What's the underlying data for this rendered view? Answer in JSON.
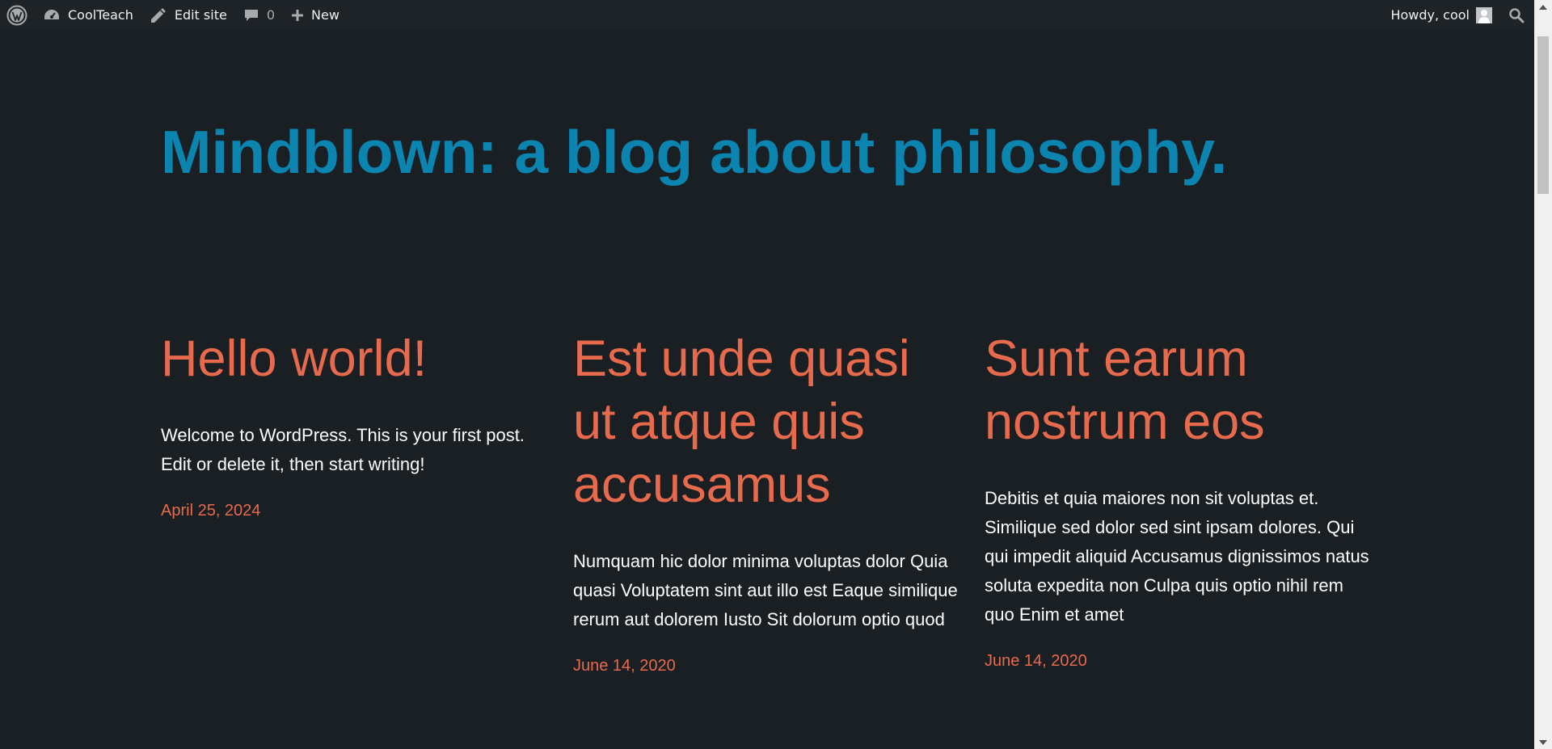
{
  "admin_bar": {
    "site_name": "CoolTeach",
    "edit_site": "Edit site",
    "comments_count": "0",
    "new_label": "New",
    "greeting": "Howdy, cool"
  },
  "site": {
    "title": "Mindblown: a blog about philosophy."
  },
  "posts": [
    {
      "title": "Hello world!",
      "excerpt": "Welcome to WordPress. This is your first post. Edit or delete it, then start writing!",
      "date": "April 25, 2024"
    },
    {
      "title": "Est unde quasi ut atque quis accusamus",
      "excerpt": "Numquam hic dolor minima voluptas dolor Quia quasi Voluptatem sint aut illo est Eaque similique rerum aut dolorem Iusto Sit dolorum optio quod",
      "date": "June 14, 2020"
    },
    {
      "title": "Sunt earum nostrum eos",
      "excerpt": "Debitis et quia maiores non sit voluptas et. Similique sed dolor sed sint ipsam dolores. Qui qui impedit aliquid Accusamus dignissimos natus soluta expedita non Culpa quis optio nihil rem quo Enim et amet",
      "date": "June 14, 2020"
    }
  ],
  "colors": {
    "background": "#1a1f24",
    "admin_bar": "#1d2327",
    "site_title": "#0b84b0",
    "accent": "#e86a4c",
    "text": "#ffffff"
  },
  "icons": {
    "wordpress": "wordpress-logo-icon",
    "dashboard": "dashboard-icon",
    "edit": "edit-site-icon",
    "comments": "comment-bubble-icon",
    "new": "plus-icon",
    "search": "search-icon"
  }
}
